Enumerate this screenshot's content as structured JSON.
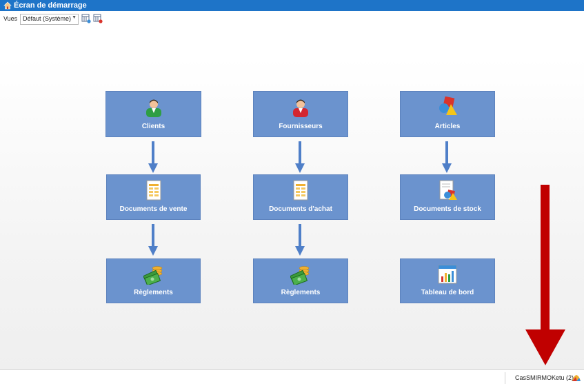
{
  "window": {
    "title": "Écran de démarrage"
  },
  "toolbar": {
    "vues_label": "Vues",
    "view_select_value": "Défaut (Système)"
  },
  "tiles": {
    "clients": "Clients",
    "fournisseurs": "Fournisseurs",
    "articles": "Articles",
    "documents_vente": "Documents de vente",
    "documents_achat": "Documents d'achat",
    "documents_stock": "Documents de stock",
    "reglements_vente": "Règlements",
    "reglements_achat": "Règlements",
    "tableau_bord": "Tableau de bord"
  },
  "statusbar": {
    "user": "CasSMIRMOKetu (2)"
  },
  "colors": {
    "titlebar": "#1e74c8",
    "tile": "#6b93ce",
    "flow_arrow": "#4f7fc8",
    "highlight_arrow": "#c00000"
  }
}
